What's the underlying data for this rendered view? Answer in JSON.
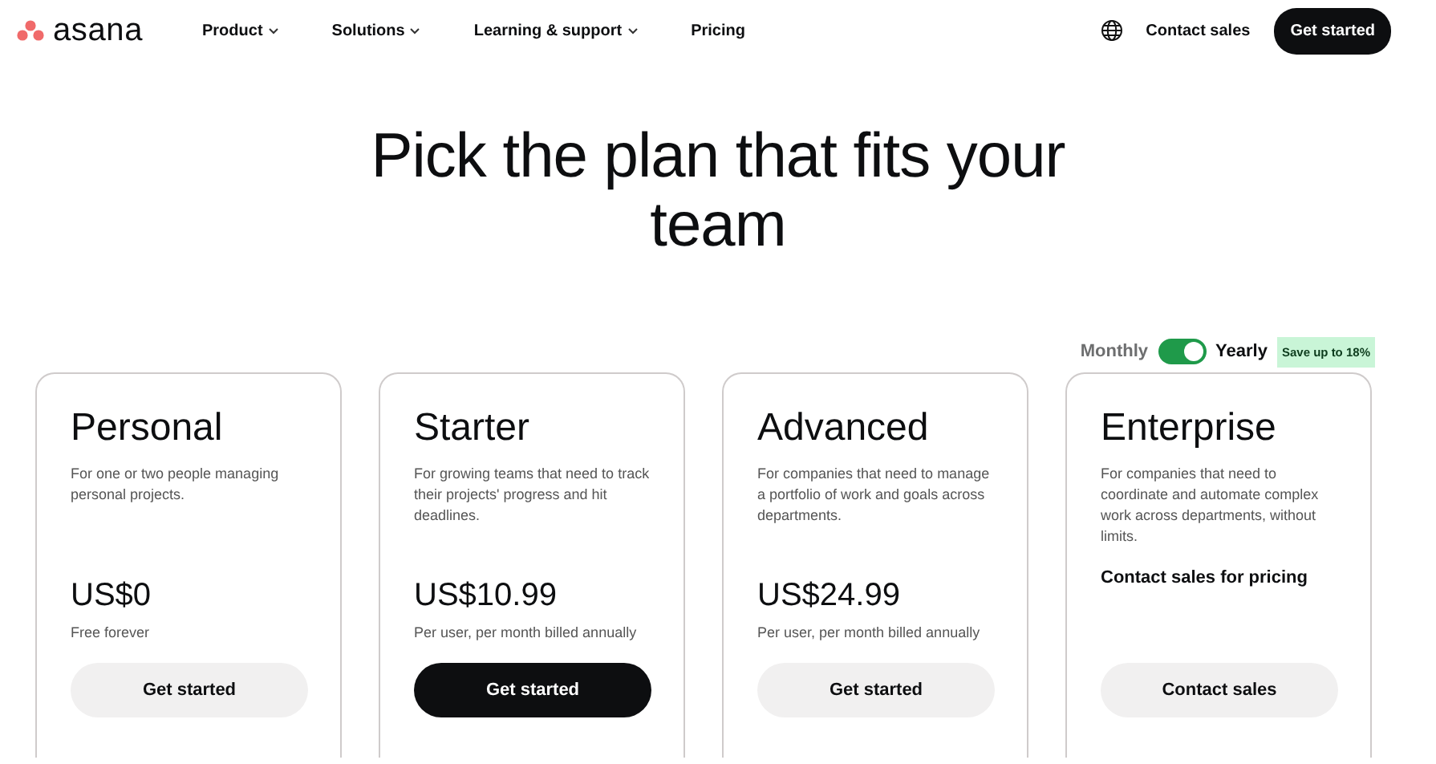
{
  "header": {
    "logo": "asana",
    "nav": [
      {
        "label": "Product",
        "dropdown": true
      },
      {
        "label": "Solutions",
        "dropdown": true
      },
      {
        "label": "Learning & support",
        "dropdown": true
      },
      {
        "label": "Pricing",
        "dropdown": false
      }
    ],
    "contact": "Contact sales",
    "cta": "Get started"
  },
  "hero": {
    "title": "Pick the plan that fits your team"
  },
  "billing": {
    "monthly": "Monthly",
    "yearly_label": "Yearly",
    "yearly": true,
    "badge": "Save up to 18%"
  },
  "plans": [
    {
      "name": "Personal",
      "description": "For one or two people managing personal projects.",
      "kind": "price",
      "price": "US$0",
      "note": "Free forever",
      "button": "Get started",
      "primary": false
    },
    {
      "name": "Starter",
      "description": "For growing teams that need to track their projects' progress and hit deadlines.",
      "kind": "price",
      "price": "US$10.99",
      "note": "Per user, per month billed annually",
      "button": "Get started",
      "primary": true
    },
    {
      "name": "Advanced",
      "description": "For companies that need to manage a portfolio of work and goals across departments.",
      "kind": "price",
      "price": "US$24.99",
      "note": "Per user, per month billed annually",
      "button": "Get started",
      "primary": false
    },
    {
      "name": "Enterprise",
      "description": "For companies that need to coordinate and automate complex work across departments, without limits.",
      "kind": "contact",
      "price": "Contact sales for pricing",
      "button": "Contact sales",
      "primary": false
    }
  ]
}
